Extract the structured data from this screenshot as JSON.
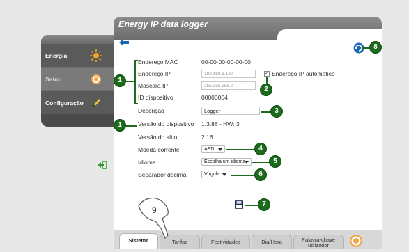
{
  "window": {
    "title": "Energy IP data logger"
  },
  "sidebar": {
    "items": [
      {
        "label": "Energia",
        "icon": "sun-icon"
      },
      {
        "label": "Setup",
        "icon": "gear-icon"
      },
      {
        "label": "Configuração",
        "icon": "pencil-icon"
      }
    ]
  },
  "form": {
    "mac_label": "Endereço MAC",
    "mac_value": "00-00-00-00-00-00",
    "ip_label": "Endereço IP",
    "ip_value": "192.168.1.180",
    "auto_ip_label": "Endereço IP automático",
    "auto_ip_checked": true,
    "mask_label": "Máscara IP",
    "mask_value": "255.255.255.0",
    "id_label": "ID dispositivo",
    "id_value": "00000004",
    "desc_label": "Descrição",
    "desc_value": "Logger",
    "ver_label": "Versão do dispositivo",
    "ver_value": "1.3.86 - HW: 3",
    "site_label": "Versão do sítio",
    "site_value": "2.16",
    "currency_label": "Moeda corrente",
    "currency_value": "AED",
    "lang_label": "Idioma",
    "lang_value": "Escolha um idioma",
    "sep_label": "Separador decimal",
    "sep_value": "Vírgula"
  },
  "callouts": [
    "1",
    "1",
    "2",
    "3",
    "4",
    "5",
    "6",
    "7",
    "8",
    "9"
  ],
  "tabs": [
    {
      "label": "Sistema",
      "active": true
    },
    {
      "label": "Tarifas"
    },
    {
      "label": "Festividades"
    },
    {
      "label": "Dia/Hora"
    },
    {
      "label_line1": "Palavra-chave",
      "label_line2": "utilizador"
    }
  ],
  "colors": {
    "accent_green": "#1c6b1c",
    "titlebar": "#7a7a7a",
    "link_blue": "#1b67b4"
  }
}
